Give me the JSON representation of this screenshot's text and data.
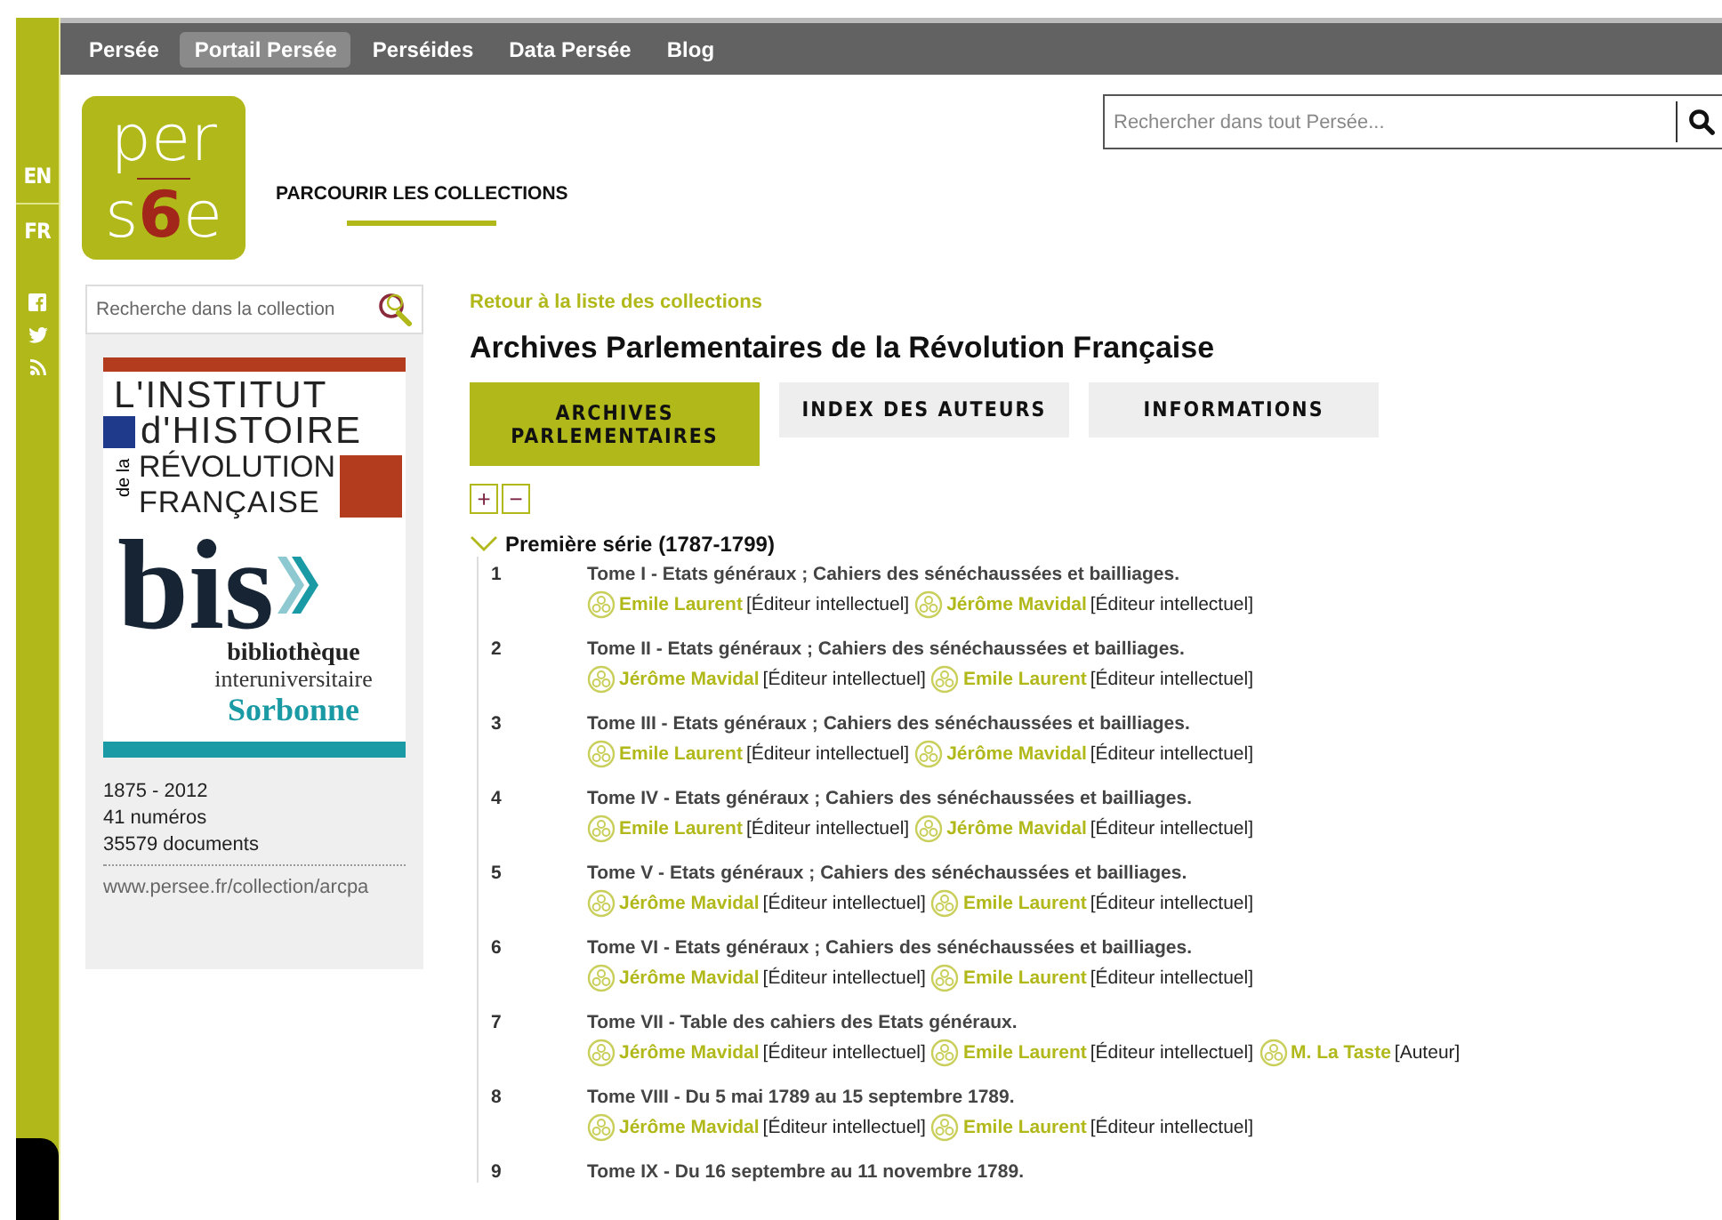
{
  "top_nav": [
    {
      "label": "Persée",
      "selected": false
    },
    {
      "label": "Portail Persée",
      "selected": true
    },
    {
      "label": "Perséides",
      "selected": false
    },
    {
      "label": "Data Persée",
      "selected": false
    },
    {
      "label": "Blog",
      "selected": false
    }
  ],
  "languages": [
    {
      "label": "EN"
    },
    {
      "label": "FR"
    }
  ],
  "logo": {
    "top": "per",
    "bottom": [
      {
        "text": "s",
        "accent": false
      },
      {
        "text": "6",
        "accent": true
      },
      {
        "text": "e",
        "accent": false
      }
    ]
  },
  "section_link": "PARCOURIR LES COLLECTIONS",
  "site_search": {
    "placeholder": "Rechercher dans tout Persée..."
  },
  "sidebar": {
    "search": {
      "placeholder": "Recherche dans la collection"
    },
    "publisher_logo": {
      "line_1": "L'INSTITUT",
      "line_2": "d'HISTOIRE",
      "vertical": "de la",
      "line_3": "RÉVOLUTION",
      "line_4": "FRANÇAISE",
      "brand": "bis",
      "sub_1": "bibliothèque",
      "sub_2": "interuniversitaire",
      "sub_3": "Sorbonne"
    },
    "facts": [
      "1875 - 2012",
      "41 numéros",
      "35579 documents"
    ],
    "url": "www.persee.fr/collection/arcpa"
  },
  "back_link": "Retour à la liste des collections",
  "title": "Archives Parlementaires de la Révolution Française",
  "tabs": [
    {
      "label": "ARCHIVES PARLEMENTAIRES",
      "selected": true
    },
    {
      "label": "INDEX DES AUTEURS",
      "selected": false
    },
    {
      "label": "INFORMATIONS",
      "selected": false
    }
  ],
  "tree_controls": [
    "+",
    "−"
  ],
  "series": {
    "label": "Première série (1787-1799)",
    "expanded": true,
    "items": [
      {
        "number": "1",
        "title": "Tome I - Etats généraux ; Cahiers des sénéchaussées et bailliages.",
        "contributors": [
          {
            "name": "Emile Laurent",
            "role": "[Éditeur intellectuel]"
          },
          {
            "name": "Jérôme Mavidal",
            "role": "[Éditeur intellectuel]"
          }
        ]
      },
      {
        "number": "2",
        "title": "Tome II - Etats généraux ; Cahiers des sénéchaussées et bailliages.",
        "contributors": [
          {
            "name": "Jérôme Mavidal",
            "role": "[Éditeur intellectuel]"
          },
          {
            "name": "Emile Laurent",
            "role": "[Éditeur intellectuel]"
          }
        ]
      },
      {
        "number": "3",
        "title": "Tome III - Etats généraux ; Cahiers des sénéchaussées et bailliages.",
        "contributors": [
          {
            "name": "Emile Laurent",
            "role": "[Éditeur intellectuel]"
          },
          {
            "name": "Jérôme Mavidal",
            "role": "[Éditeur intellectuel]"
          }
        ]
      },
      {
        "number": "4",
        "title": "Tome IV - Etats généraux ; Cahiers des sénéchaussées et bailliages.",
        "contributors": [
          {
            "name": "Emile Laurent",
            "role": "[Éditeur intellectuel]"
          },
          {
            "name": "Jérôme Mavidal",
            "role": "[Éditeur intellectuel]"
          }
        ]
      },
      {
        "number": "5",
        "title": "Tome V - Etats généraux ; Cahiers des sénéchaussées et bailliages.",
        "contributors": [
          {
            "name": "Jérôme Mavidal",
            "role": "[Éditeur intellectuel]"
          },
          {
            "name": "Emile Laurent",
            "role": "[Éditeur intellectuel]"
          }
        ]
      },
      {
        "number": "6",
        "title": "Tome VI - Etats généraux ; Cahiers des sénéchaussées et bailliages.",
        "contributors": [
          {
            "name": "Jérôme Mavidal",
            "role": "[Éditeur intellectuel]"
          },
          {
            "name": "Emile Laurent",
            "role": "[Éditeur intellectuel]"
          }
        ]
      },
      {
        "number": "7",
        "title": "Tome VII - Table des cahiers des Etats généraux.",
        "contributors": [
          {
            "name": "Jérôme Mavidal",
            "role": "[Éditeur intellectuel]"
          },
          {
            "name": "Emile Laurent",
            "role": "[Éditeur intellectuel]"
          },
          {
            "name": "M. La Taste",
            "role": "[Auteur]"
          }
        ]
      },
      {
        "number": "8",
        "title": "Tome VIII - Du 5 mai 1789 au 15 septembre 1789.",
        "contributors": [
          {
            "name": "Jérôme Mavidal",
            "role": "[Éditeur intellectuel]"
          },
          {
            "name": "Emile Laurent",
            "role": "[Éditeur intellectuel]"
          }
        ]
      },
      {
        "number": "9",
        "title": "Tome IX - Du 16 septembre au 11 novembre 1789."
      }
    ]
  }
}
